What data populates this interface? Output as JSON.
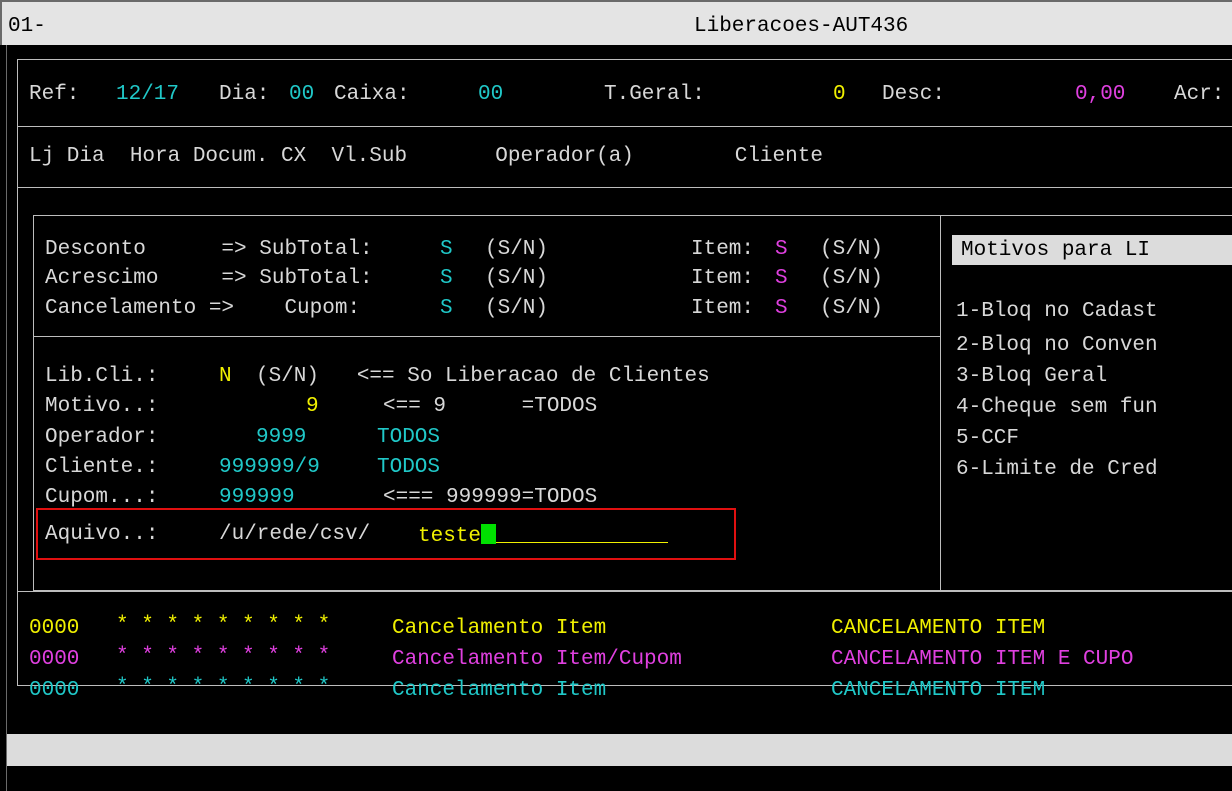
{
  "window": {
    "id": "01-",
    "title": "Liberacoes-AUT436"
  },
  "header": {
    "ref_label": "Ref:",
    "ref_value": "12/17",
    "dia_label": "Dia:",
    "dia_value": "00",
    "caixa_label": "Caixa:",
    "caixa_value": "00",
    "tgeral_label": "T.Geral:",
    "tgeral_value": "0",
    "desc_label": "Desc:",
    "desc_value": "0,00",
    "acr_label": "Acr:"
  },
  "columns": "Lj Dia  Hora Docum. CX  Vl.Sub       Operador(a)        Cliente",
  "permissions": [
    {
      "name": "Desconto      => SubTotal:",
      "sub_value": "S",
      "sub_hint": "(S/N)",
      "item_label": "Item:",
      "item_value": "S",
      "item_hint": "(S/N)"
    },
    {
      "name": "Acrescimo     => SubTotal:",
      "sub_value": "S",
      "sub_hint": "(S/N)",
      "item_label": "Item:",
      "item_value": "S",
      "item_hint": "(S/N)"
    },
    {
      "name": "Cancelamento =>    Cupom:",
      "sub_value": "S",
      "sub_hint": "(S/N)",
      "item_label": "Item:",
      "item_value": "S",
      "item_hint": "(S/N)"
    }
  ],
  "filters": {
    "libcli_label": "Lib.Cli.:",
    "libcli_value": "N",
    "libcli_hint": "(S/N)   <== So Liberacao de Clientes",
    "motivo_label": "Motivo..:",
    "motivo_value": "9",
    "motivo_hint": "<== 9      =TODOS",
    "operador_label": "Operador:",
    "operador_value": "9999",
    "operador_desc": "TODOS",
    "cliente_label": "Cliente.:",
    "cliente_value": "999999/9",
    "cliente_desc": "TODOS",
    "cupom_label": "Cupom...:",
    "cupom_value": "999999",
    "cupom_hint": "<=== 999999=TODOS",
    "arquivo_label": "Aquivo..:",
    "arquivo_path": "/u/rede/csv/",
    "arquivo_value": "teste"
  },
  "motivos": {
    "title": "Motivos para LI",
    "items": [
      "1-Bloq no Cadast",
      "2-Bloq no Conven",
      "3-Bloq Geral",
      "4-Cheque sem fun",
      "5-CCF",
      "6-Limite de Cred"
    ]
  },
  "records": [
    {
      "code": "0000",
      "stars": "* * * * * * * * *",
      "desc": "Cancelamento Item",
      "type": "CANCELAMENTO ITEM"
    },
    {
      "code": "0000",
      "stars": "* * * * * * * * *",
      "desc": "Cancelamento Item/Cupom",
      "type": "CANCELAMENTO ITEM E CUPO"
    },
    {
      "code": "0000",
      "stars": "* * * * * * * * *",
      "desc": "Cancelamento Item",
      "type": "CANCELAMENTO ITEM"
    }
  ],
  "colors": {
    "background": "#000000",
    "cyan": "#20c8c8",
    "yellow": "#f0f000",
    "magenta": "#e040e0",
    "highlight": "#e01010"
  }
}
